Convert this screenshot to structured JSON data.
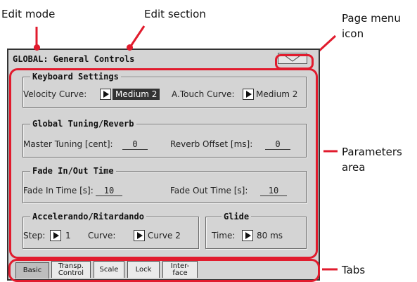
{
  "annotations": {
    "edit_mode": "Edit mode",
    "edit_section": "Edit section",
    "page_menu_icon_line1": "Page menu",
    "page_menu_icon_line2": "icon",
    "parameters_area_line1": "Parameters",
    "parameters_area_line2": "area",
    "tabs": "Tabs"
  },
  "header": {
    "title": "GLOBAL: General Controls",
    "page_menu_icon": "triangle-down-icon"
  },
  "groups": {
    "keyboard": {
      "title": "Keyboard Settings",
      "velocity_label": "Velocity Curve:",
      "velocity_value": "Medium 2",
      "atouch_label": "A.Touch Curve:",
      "atouch_value": "Medium 2"
    },
    "tuning": {
      "title": "Global Tuning/Reverb",
      "master_label": "Master Tuning [cent]:",
      "master_value": "0",
      "reverb_label": "Reverb Offset [ms]:",
      "reverb_value": "0"
    },
    "fade": {
      "title": "Fade In/Out Time",
      "fadein_label": "Fade In Time [s]:",
      "fadein_value": "10",
      "fadeout_label": "Fade Out Time [s]:",
      "fadeout_value": "10"
    },
    "accel": {
      "title": "Accelerando/Ritardando",
      "step_label": "Step:",
      "step_value": "1",
      "curve_label": "Curve:",
      "curve_value": "Curve 2"
    },
    "glide": {
      "title": "Glide",
      "time_label": "Time:",
      "time_value": "80 ms"
    }
  },
  "tabs": [
    {
      "label": "Basic",
      "active": true
    },
    {
      "label": "Transp.\nControl",
      "active": false
    },
    {
      "label": "Scale",
      "active": false
    },
    {
      "label": "Lock",
      "active": false
    },
    {
      "label": "Inter-\nface",
      "active": false
    }
  ],
  "colors": {
    "highlight": "#e11b2d",
    "screen_bg": "#d4d4d4",
    "selected_bg": "#333333"
  }
}
